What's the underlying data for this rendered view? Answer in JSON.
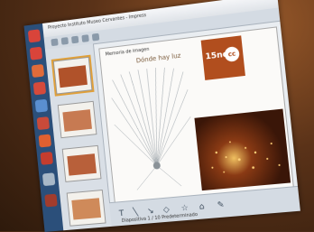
{
  "window": {
    "title": "Proyecto Instituto Museo Cervantes - Impress"
  },
  "slide": {
    "heading": "Memoria de imagen",
    "subtitle": "Dónde hay luz",
    "logo_text": "15ndi",
    "logo_mark": "cc"
  },
  "toolbar": {
    "icons": [
      "text-icon",
      "line-icon",
      "arrow-icon",
      "shapes-icon",
      "star-icon",
      "house-icon",
      "pen-icon"
    ]
  },
  "status": {
    "text": "Diapositiva 1 / 10   Predeterminado"
  },
  "colors": {
    "accent": "#b14e1e",
    "taskbar": "#2b4f7a"
  }
}
